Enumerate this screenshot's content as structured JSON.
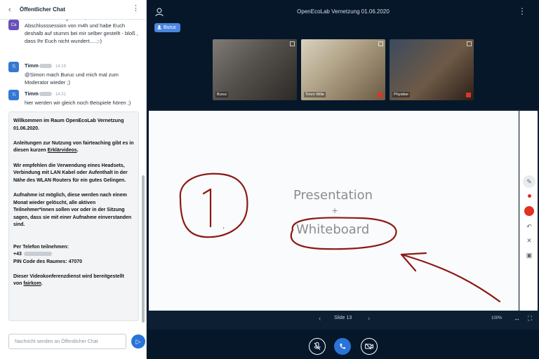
{
  "chat": {
    "title": "Öffentlicher Chat",
    "back_icon": "‹",
    "more_icon": "⋮",
    "messages": [
      {
        "initials": "Ca",
        "color": "#6b4fbb",
        "text": "bin schon mal eingetreten, aber noch halb bei Abschlusssession von m4h und habe Euch deshalb auf stumm bei mir selber gestellt - bloß , dass Ihr Euch nicht wundert.....;-)"
      },
      {
        "initials": "Ti",
        "color": "#3478d4",
        "name": "Timm",
        "time": "14:19",
        "text": "@Simon mach Buruc und mich mal zum Moderator wieder ;)"
      },
      {
        "initials": "Ti",
        "color": "#3478d4",
        "name": "Timm",
        "time": "14:31",
        "text": "hier werden wir gleich noch Beispiele hören ;)"
      }
    ],
    "welcome": {
      "line1_a": "Willkommen im Raum ",
      "line1_b": "OpenEcoLab Vernetzung 01.06.2020.",
      "para2_a": "Anleitungen zur Nutzung von fairteaching gibt es in diesen kurzen ",
      "para2_link": "Erklärvideos",
      "para2_b": ".",
      "para3": "Wir empfehlen die Verwendung eines Headsets, Verbindung mit LAN Kabel oder Aufenthalt in der Nähe des WLAN Routers für ein gutes Gelingen.",
      "para4": "Aufnahme ist möglich, diese werden nach einem Monat wieder gelöscht, alle aktiven Teilnehmer*innen sollen vor oder in der Sitzung sagen, dass sie mit einer Aufnahme einverstanden sind.",
      "phone_label": "Per Telefon teilnehmen:",
      "phone_prefix": "+43",
      "pin": "PIN Code des Raumes: 47070",
      "footer_a": "Dieser Videokonferenzdienst wird bereitgestellt von ",
      "footer_link": "fairkom",
      "footer_b": "."
    },
    "input_placeholder": "Nachricht senden an Öffentlicher Chat",
    "send_icon": "▷"
  },
  "main": {
    "title": "OpenEcoLab Vernetzung 01.06.2020",
    "user_icon": "user-list-icon",
    "more_icon": "⋮",
    "talker": "Buruc",
    "videos": [
      {
        "name": "Buruc"
      },
      {
        "name": "Timm Wille"
      },
      {
        "name": "Physiker"
      }
    ],
    "slide": {
      "title": "Presentation",
      "plus": "+",
      "subtitle": "Whiteboard",
      "annotation_text": "1."
    },
    "controls": {
      "prev": "‹",
      "slide_label": "Slide 13",
      "next": "›",
      "zoom": "100%",
      "fit": "↔",
      "fullscreen": "⛶"
    },
    "annotation_color": "#8b1a14"
  }
}
